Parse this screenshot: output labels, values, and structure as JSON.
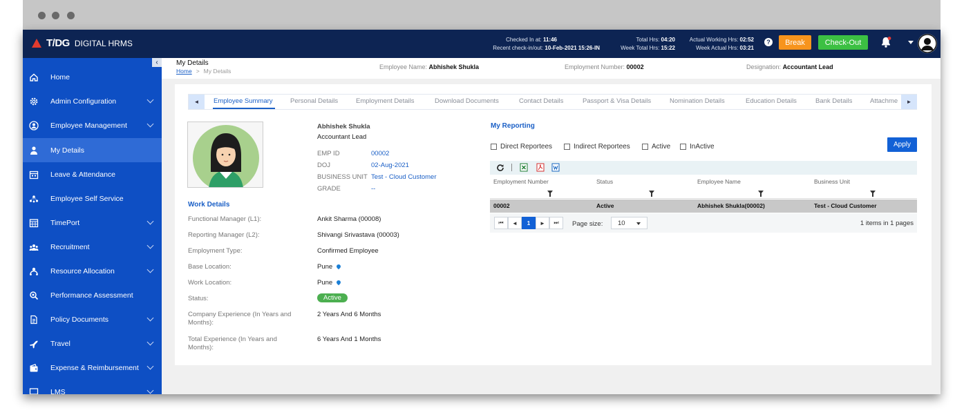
{
  "header": {
    "brand": "T/DG",
    "product": "DIGITAL HRMS",
    "checked_in_label": "Checked In at:",
    "checked_in_value": "11:46",
    "recent_label": "Recent check-in/out:",
    "recent_value": "10-Feb-2021 15:26-IN",
    "total_hrs_label": "Total Hrs:",
    "total_hrs_value": "04:20",
    "week_total_label": "Week Total Hrs:",
    "week_total_value": "15:22",
    "actual_label": "Actual Working Hrs:",
    "actual_value": "02:52",
    "week_actual_label": "Week Actual Hrs:",
    "week_actual_value": "03:21",
    "help_glyph": "?",
    "break_label": "Break",
    "checkout_label": "Check-Out"
  },
  "sidebar": {
    "collapse_glyph": "‹",
    "items": [
      {
        "label": "Home",
        "icon": "home-icon"
      },
      {
        "label": "Admin Configuration",
        "icon": "gear-icon"
      },
      {
        "label": "Employee Management",
        "icon": "user-circle-icon"
      },
      {
        "label": "My Details",
        "icon": "person-icon"
      },
      {
        "label": "Leave & Attendance",
        "icon": "calendar-icon"
      },
      {
        "label": "Employee Self Service",
        "icon": "network-icon"
      },
      {
        "label": "TimePort",
        "icon": "calendar-grid-icon"
      },
      {
        "label": "Recruitment",
        "icon": "team-icon"
      },
      {
        "label": "Resource Allocation",
        "icon": "resource-icon"
      },
      {
        "label": "Performance Assessment",
        "icon": "magnifier-icon"
      },
      {
        "label": "Policy Documents",
        "icon": "document-icon"
      },
      {
        "label": "Travel",
        "icon": "plane-icon"
      },
      {
        "label": "Expense & Reimbursement",
        "icon": "wallet-icon"
      },
      {
        "label": "LMS",
        "icon": "screen-icon"
      }
    ]
  },
  "page": {
    "title": "My Details",
    "breadcrumb_home": "Home",
    "breadcrumb_sep": ">",
    "breadcrumb_current": "My Details",
    "emp_name_label": "Employee Name:",
    "emp_name_value": "Abhishek Shukla",
    "emp_num_label": "Employment Number:",
    "emp_num_value": "00002",
    "designation_label": "Designation:",
    "designation_value": "Accountant Lead"
  },
  "tabs": {
    "left_glyph": "◄",
    "right_glyph": "►",
    "items": [
      "Employee Summary",
      "Personal Details",
      "Employment Details",
      "Download Documents",
      "Contact Details",
      "Passport & Visa Details",
      "Nomination Details",
      "Education Details",
      "Bank Details",
      "Attachme"
    ]
  },
  "profile": {
    "name": "Abhishek Shukla",
    "role": "Accountant Lead",
    "emp_id_label": "EMP ID",
    "emp_id_value": "00002",
    "doj_label": "DOJ",
    "doj_value": "02-Aug-2021",
    "bu_label": "BUSINESS UNIT",
    "bu_value": "Test - Cloud Customer",
    "grade_label": "GRADE",
    "grade_value": "--"
  },
  "work": {
    "title": "Work Details",
    "rows": [
      {
        "label": "Functional Manager (L1):",
        "value": "Ankit Sharma (00008)"
      },
      {
        "label": "Reporting Manager (L2):",
        "value": "Shivangi Srivastava (00003)"
      },
      {
        "label": "Employment Type:",
        "value": "Confirmed Employee"
      },
      {
        "label": "Base Location:",
        "value": "Pune"
      },
      {
        "label": "Work Location:",
        "value": "Pune"
      },
      {
        "label": "Status:",
        "value": "Active"
      },
      {
        "label_1": "Company Experience (In Years and",
        "label_2": "Months):",
        "value": "2 Years And 6 Months"
      },
      {
        "label_1": "Total Experience (In Years and",
        "label_2": "Months):",
        "value": "6 Years And 1 Months"
      }
    ]
  },
  "reporting": {
    "title": "My Reporting",
    "filters": [
      "Direct Reportees",
      "Indirect Reportees",
      "Active",
      "InActive"
    ],
    "apply_label": "Apply",
    "columns": [
      "Employment Number",
      "Status",
      "Employee Name",
      "Business Unit"
    ],
    "row": [
      "00002",
      "Active",
      "Abhishek Shukla(00002)",
      "Test - Cloud Customer"
    ],
    "pager": {
      "first": "⏮",
      "prev": "◄",
      "current": "1",
      "next": "►",
      "last": "⏭",
      "page_size_label": "Page size:",
      "page_size_value": "10",
      "summary": "1 items in 1 pages"
    }
  },
  "colors": {
    "topbar": "#0d2453",
    "sidebar": "#0e4fc4",
    "accent": "#1a5fc6",
    "break": "#f7941d",
    "checkout": "#3cc043",
    "active_badge": "#4caf50"
  }
}
